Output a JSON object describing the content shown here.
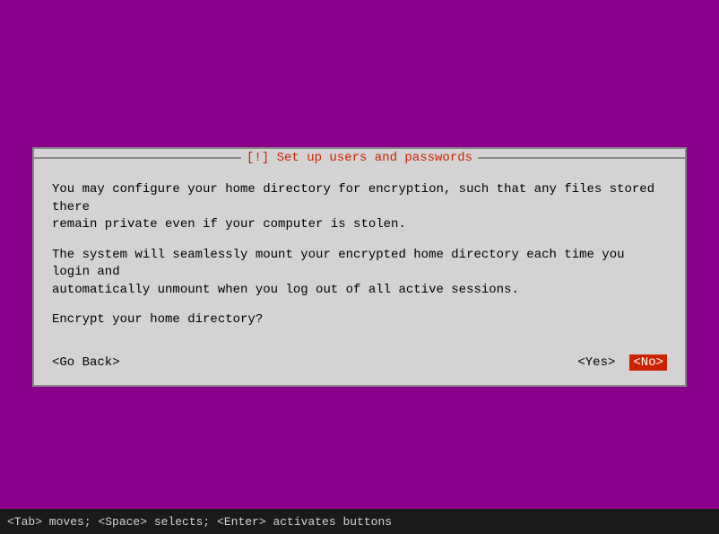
{
  "background_color": "#8b008b",
  "dialog": {
    "title": "[!] Set up users and passwords",
    "title_bracket_left": "─────────────",
    "title_bracket_right": "─────────────",
    "paragraph1": "You may configure your home directory for encryption, such that any files stored there\nremain private even if your computer is stolen.",
    "paragraph2": "The system will seamlessly mount your encrypted home directory each time you login and\nautomatically unmount when you log out of all active sessions.",
    "paragraph3": "Encrypt your home directory?",
    "btn_go_back": "<Go Back>",
    "btn_yes": "<Yes>",
    "btn_no": "<No>"
  },
  "bottom_bar": {
    "text": "<Tab> moves; <Space> selects; <Enter> activates buttons"
  }
}
